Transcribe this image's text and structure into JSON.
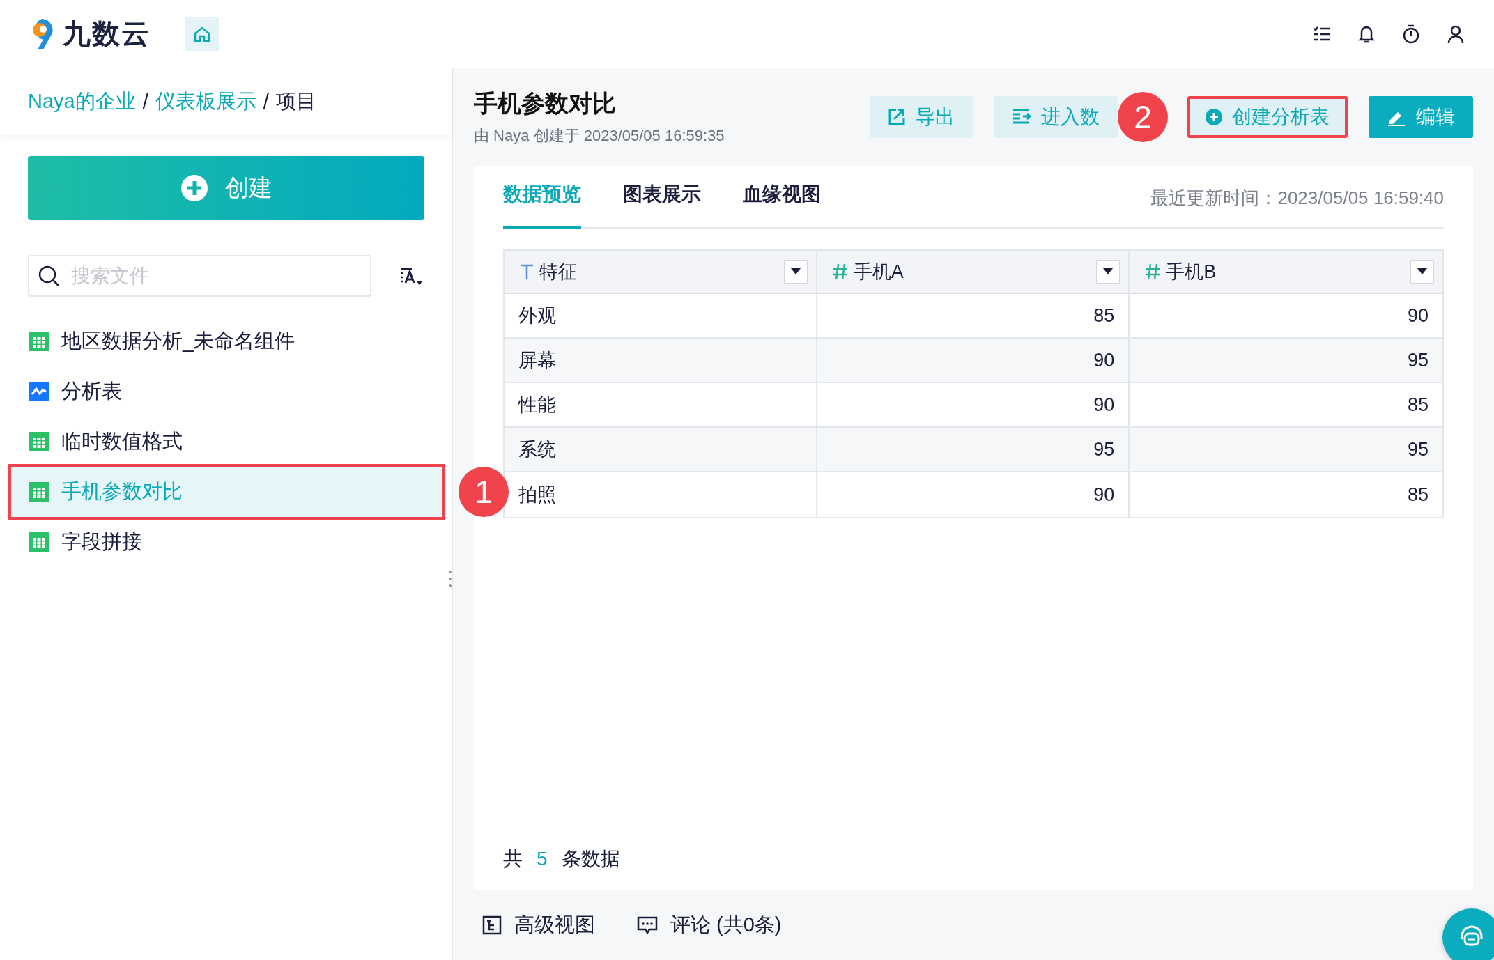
{
  "topbar": {
    "logo_text": "九数云"
  },
  "breadcrumb": [
    {
      "label": "Naya的企业",
      "link": true
    },
    {
      "label": "/",
      "link": false
    },
    {
      "label": "仪表板展示",
      "link": true
    },
    {
      "label": "/",
      "link": false
    },
    {
      "label": "项目",
      "link": false
    }
  ],
  "create_button": {
    "label": "创建"
  },
  "search": {
    "placeholder": "搜索文件"
  },
  "sidebar": {
    "items": [
      {
        "label": "地区数据分析_未命名组件",
        "kind": "table",
        "selected": false,
        "highlighted": false
      },
      {
        "label": "分析表",
        "kind": "chart",
        "selected": false,
        "highlighted": false
      },
      {
        "label": "临时数值格式",
        "kind": "table",
        "selected": false,
        "highlighted": false
      },
      {
        "label": "手机参数对比",
        "kind": "table",
        "selected": true,
        "highlighted": true,
        "badge": "1"
      },
      {
        "label": "字段拼接",
        "kind": "table",
        "selected": false,
        "highlighted": false
      }
    ]
  },
  "header": {
    "title": "手机参数对比",
    "subtitle": "由 Naya 创建于 2023/05/05 16:59:35",
    "buttons": [
      {
        "label": "导出",
        "kind": "export",
        "primary": false,
        "highlighted": false
      },
      {
        "label": "进入数",
        "kind": "enter",
        "primary": false,
        "highlighted": false
      },
      {
        "label": "创建分析表",
        "kind": "create",
        "primary": false,
        "highlighted": true,
        "badge": "2"
      },
      {
        "label": "编辑",
        "kind": "edit",
        "primary": true,
        "highlighted": false
      }
    ]
  },
  "tabs": [
    {
      "label": "数据预览",
      "selected": true
    },
    {
      "label": "图表展示",
      "selected": false
    },
    {
      "label": "血缘视图",
      "selected": false
    }
  ],
  "updated": "最近更新时间：2023/05/05 16:59:40",
  "table": {
    "columns": [
      {
        "label": "特征",
        "kind": "text"
      },
      {
        "label": "手机A",
        "kind": "number"
      },
      {
        "label": "手机B",
        "kind": "number"
      }
    ],
    "rows": [
      [
        "外观",
        "85",
        "90"
      ],
      [
        "屏幕",
        "90",
        "95"
      ],
      [
        "性能",
        "90",
        "85"
      ],
      [
        "系统",
        "95",
        "95"
      ],
      [
        "拍照",
        "90",
        "85"
      ]
    ]
  },
  "footer": {
    "prefix": "共",
    "count": "5",
    "suffix": "条数据"
  },
  "bottom_bar": [
    {
      "label": "高级视图",
      "kind": "view"
    },
    {
      "label": "评论 (共0条)",
      "kind": "comment"
    }
  ]
}
